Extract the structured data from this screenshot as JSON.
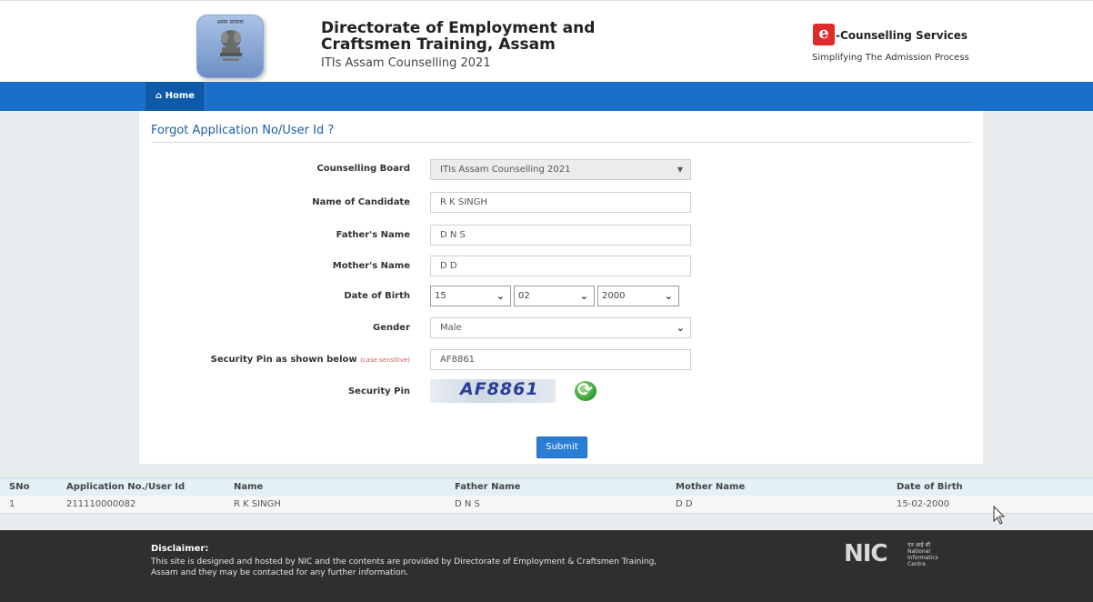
{
  "header": {
    "emblem_text": "असम सरकार",
    "title": "Directorate of Employment and Craftsmen Training, Assam",
    "subtitle": "ITIs Assam Counselling 2021",
    "ec_logo_letter": "e",
    "ec_title": "-Counselling Services",
    "ec_tagline": "Simplifying The Admission Process"
  },
  "nav": {
    "home_icon": "home-icon",
    "home_label": "Home"
  },
  "form": {
    "title": "Forgot Application No/User Id ?",
    "counselling_board": {
      "label": "Counselling Board",
      "value": "ITIs Assam Counselling 2021"
    },
    "candidate_name": {
      "label": "Name of Candidate",
      "value": "R K SINGH"
    },
    "father_name": {
      "label": "Father's Name",
      "value": "D N S"
    },
    "mother_name": {
      "label": "Mother's Name",
      "value": "D D"
    },
    "dob": {
      "label": "Date of Birth",
      "day": "15",
      "month": "02",
      "year": "2000"
    },
    "gender": {
      "label": "Gender",
      "value": "Male"
    },
    "security_pin_input": {
      "label": "Security Pin as shown below",
      "hint": "(case sensitive)",
      "value": "AF8861"
    },
    "security_pin": {
      "label": "Security Pin",
      "captcha": "AF8861",
      "refresh_icon": "refresh-icon"
    },
    "submit_label": "Submit"
  },
  "results": {
    "headers": [
      "SNo",
      "Application No./User Id",
      "Name",
      "Father Name",
      "Mother Name",
      "Date of Birth"
    ],
    "rows": [
      [
        "1",
        "211110000082",
        "R K SINGH",
        "D N S",
        "D D",
        "15-02-2000"
      ]
    ]
  },
  "footer": {
    "disclaimer_heading": "Disclaimer:",
    "disclaimer_text": "This site is designed and hosted by NIC and the contents are provided by Directorate of Employment & Craftsmen Training, Assam and they may be contacted for any further information.",
    "nic_logo": "NIC",
    "nic_hindi": "एन आई सी",
    "nic_caption": "National Informatics Centre"
  },
  "colors": {
    "nav_blue": "#1a6fc9",
    "title_blue": "#1a5ea8",
    "footer_dark": "#2f2f2f",
    "table_header": "#e3f0f5"
  }
}
